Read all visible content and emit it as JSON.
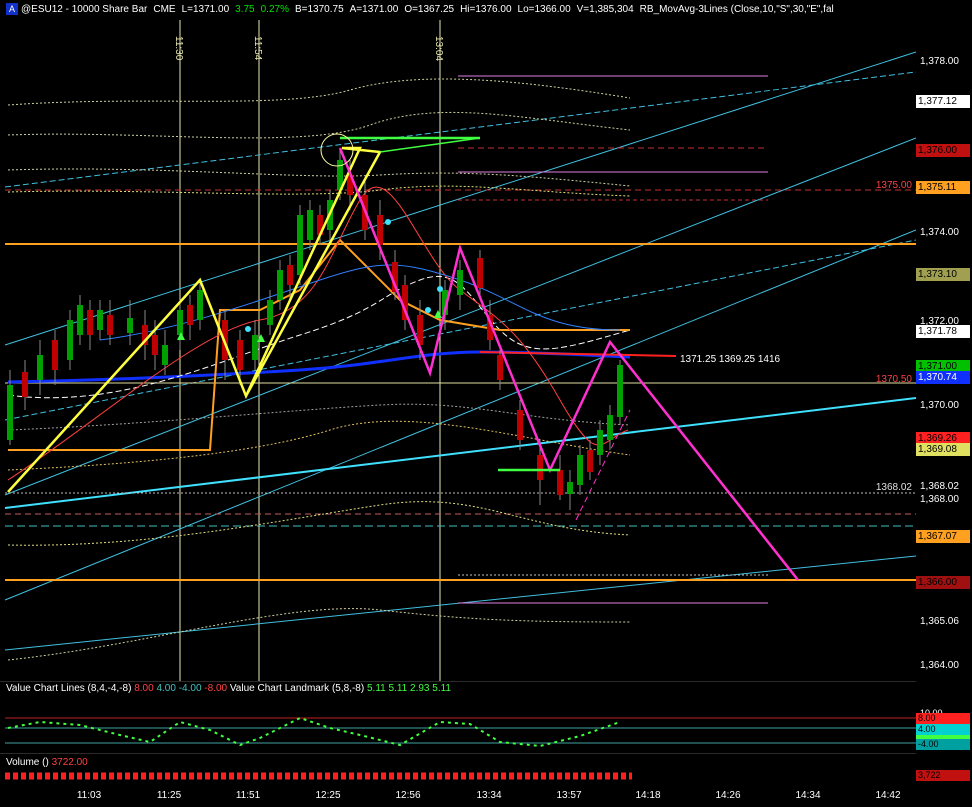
{
  "header": {
    "tag": "A",
    "symbol": "@ESU12 - 10000 Share Bar",
    "exchange": "CME",
    "last": "L=1371.00",
    "change": "3.75",
    "change_pct": "0.27%",
    "bid": "B=1370.75",
    "ask": "A=1371.00",
    "open": "O=1367.25",
    "high": "Hi=1376.00",
    "low": "Lo=1366.00",
    "volume": "V=1,385,304",
    "study": "RB_MovAvg-3Lines (Close,10,\"S\",30,\"E\",fal"
  },
  "price_axis": {
    "labels": [
      "1,378.00",
      "1,377.12",
      "1,376.00",
      "1,375.11",
      "1,374.00",
      "1,373.10",
      "1,372.00",
      "1,371.78",
      "1,371.00",
      "1,370.74",
      "1,370.00",
      "1,369.26",
      "1,369.08",
      "1,368.02",
      "1,368.00",
      "1,367.07",
      "1,366.00",
      "1,365.06",
      "1,364.00"
    ],
    "lower_labels": [
      "10.00",
      "8.00",
      "4.00",
      "0.00",
      "-4.00",
      "3,722"
    ]
  },
  "time_axis": {
    "labels": [
      "11:03",
      "11:25",
      "11:51",
      "12:25",
      "12:56",
      "13:34",
      "13:57",
      "14:18",
      "14:26",
      "14:34",
      "14:42"
    ]
  },
  "vertical_markers": [
    "11:30",
    "11:54",
    "13:04"
  ],
  "annotations": {
    "level_1375": "1375.00",
    "level_1370_50": "1370.50",
    "level_1368_02": "1368.02",
    "info_text": "1371.25  1369.25  1416"
  },
  "value_chart": {
    "name": "Value Chart Lines (8,4,-4,-8)",
    "v1": "8.00",
    "v2": "4.00",
    "v3": "-4.00",
    "v4": "-8.00",
    "landmark": "Value Chart Landmark (5,8,-8)",
    "l1": "5.11",
    "l2": "5.11",
    "l3": "2.93",
    "l4": "5.11"
  },
  "volume": {
    "name": "Volume ()",
    "value": "3722.00"
  },
  "colors": {
    "up": "#00a000",
    "down": "#c00000",
    "yellow": "#ffff40",
    "magenta": "#ff30d0",
    "orange": "#ffa020",
    "cyan": "#40e0ff",
    "blue": "#1030ff"
  }
}
